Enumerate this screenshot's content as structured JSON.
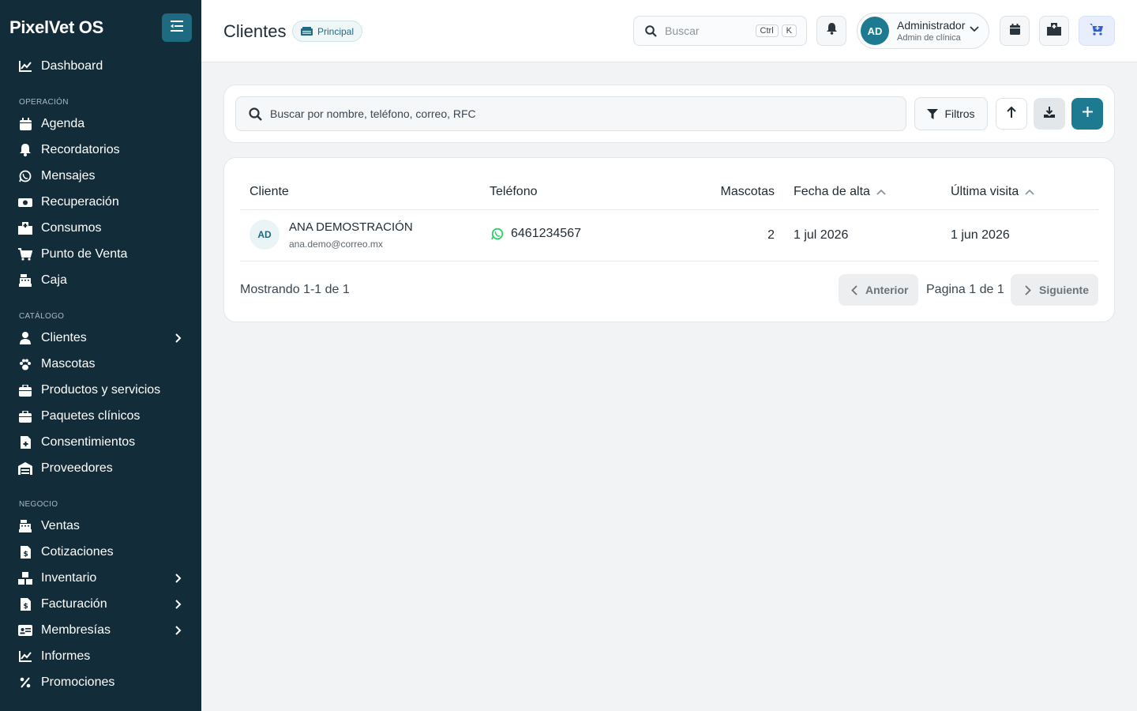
{
  "app": {
    "brand": "PixelVet OS"
  },
  "sidebar": {
    "dashboard": "Dashboard",
    "sections": {
      "operacion": "OPERACIÓN",
      "catalogo": "CATÁLOGO",
      "negocio": "NEGOCIO"
    },
    "operacion": [
      "Agenda",
      "Recordatorios",
      "Mensajes",
      "Recuperación",
      "Consumos",
      "Punto de Venta",
      "Caja"
    ],
    "catalogo": [
      "Clientes",
      "Mascotas",
      "Productos y servicios",
      "Paquetes clínicos",
      "Consentimientos",
      "Proveedores"
    ],
    "negocio": [
      "Ventas",
      "Cotizaciones",
      "Inventario",
      "Facturación",
      "Membresías",
      "Informes",
      "Promociones"
    ]
  },
  "header": {
    "title": "Clientes",
    "branch_badge": "Principal",
    "search_placeholder": "Buscar",
    "kbd_ctrl": "Ctrl",
    "kbd_k": "K",
    "user": {
      "initials": "AD",
      "name": "Administrador",
      "role": "Admin de clínica"
    }
  },
  "toolbar": {
    "search_placeholder": "Buscar por nombre, teléfono, correo, RFC",
    "filters_label": "Filtros"
  },
  "table": {
    "columns": [
      "Cliente",
      "Teléfono",
      "Mascotas",
      "Fecha de alta",
      "Última visita"
    ],
    "rows": [
      {
        "initials": "AD",
        "name": "ANA DEMOSTRACIÓN",
        "email": "ana.demo@correo.mx",
        "phone": "6461234567",
        "pets": "2",
        "created": "1 jul 2026",
        "last_visit": "1 jun 2026"
      }
    ]
  },
  "pagination": {
    "showing": "Mostrando 1-1 de 1",
    "prev": "Anterior",
    "page": "Pagina 1 de 1",
    "next": "Siguiente"
  },
  "colors": {
    "sidebar_bg": "#132c3a",
    "accent": "#1e6a80",
    "whatsapp": "#25d366"
  }
}
